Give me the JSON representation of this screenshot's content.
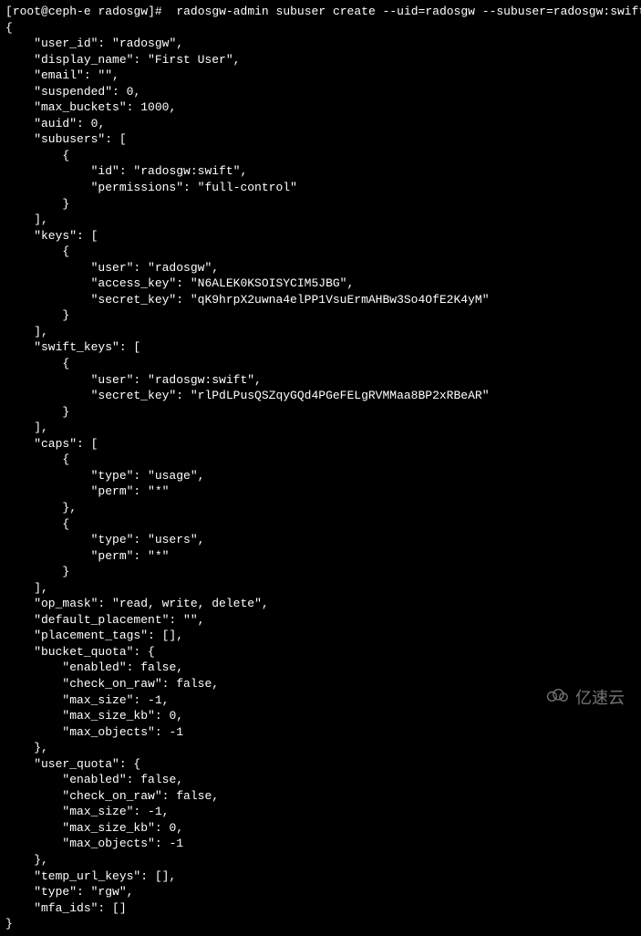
{
  "prompt": {
    "user": "root",
    "host": "ceph-e",
    "cwd": "radosgw",
    "symbol": "#"
  },
  "command": "radosgw-admin subuser create --uid=radosgw --subuser=radosgw:swift --access=full",
  "output": {
    "user_id": "radosgw",
    "display_name": "First User",
    "email": "",
    "suspended": 0,
    "max_buckets": 1000,
    "auid": 0,
    "subusers": [
      {
        "id": "radosgw:swift",
        "permissions": "full-control"
      }
    ],
    "keys": [
      {
        "user": "radosgw",
        "access_key": "N6ALEK0KSOISYCIM5JBG",
        "secret_key": "qK9hrpX2uwna4elPP1VsuErmAHBw3So4OfE2K4yM"
      }
    ],
    "swift_keys": [
      {
        "user": "radosgw:swift",
        "secret_key": "rlPdLPusQSZqyGQd4PGeFELgRVMMaa8BP2xRBeAR"
      }
    ],
    "caps": [
      {
        "type": "usage",
        "perm": "*"
      },
      {
        "type": "users",
        "perm": "*"
      }
    ],
    "op_mask": "read, write, delete",
    "default_placement": "",
    "placement_tags": [],
    "bucket_quota": {
      "enabled": false,
      "check_on_raw": false,
      "max_size": -1,
      "max_size_kb": 0,
      "max_objects": -1
    },
    "user_quota": {
      "enabled": false,
      "check_on_raw": false,
      "max_size": -1,
      "max_size_kb": 0,
      "max_objects": -1
    },
    "temp_url_keys": [],
    "type": "rgw",
    "mfa_ids": []
  },
  "watermark": "亿速云"
}
